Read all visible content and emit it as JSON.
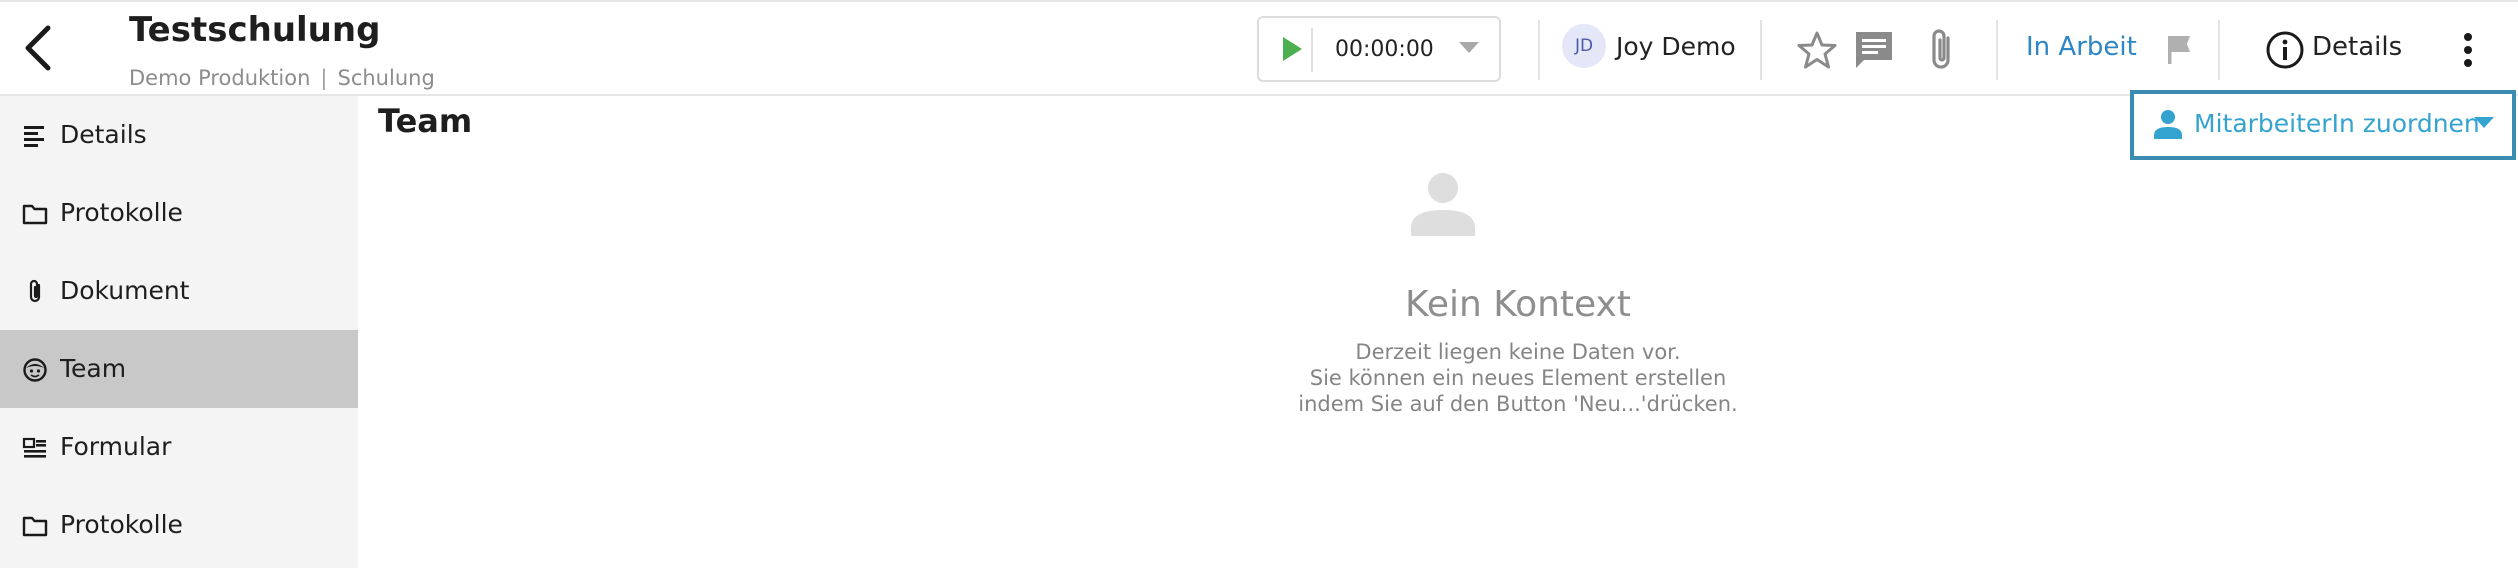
{
  "header": {
    "title": "Testschulung",
    "breadcrumb": [
      "Demo Produktion",
      "Schulung"
    ],
    "breadcrumb_separator": "|",
    "timer": {
      "value": "00:00:00"
    },
    "user": {
      "initials": "JD",
      "name": "Joy Demo"
    },
    "status": {
      "label": "In Arbeit",
      "color": "#2f86c5"
    },
    "details_label": "Details"
  },
  "sidebar": {
    "items": [
      {
        "label": "Details",
        "icon": "notes-icon",
        "active": false
      },
      {
        "label": "Protokolle",
        "icon": "folder-icon",
        "active": false
      },
      {
        "label": "Dokument",
        "icon": "paperclip-icon",
        "active": false
      },
      {
        "label": "Team",
        "icon": "face-icon",
        "active": true
      },
      {
        "label": "Formular",
        "icon": "form-icon",
        "active": false
      },
      {
        "label": "Protokolle",
        "icon": "folder-icon",
        "active": false
      }
    ]
  },
  "main": {
    "section_title": "Team",
    "assign_button": {
      "label": "MitarbeiterIn zuordnen",
      "color": "#34a3cf"
    },
    "empty_state": {
      "title": "Kein Kontext",
      "lines": [
        "Derzeit liegen keine Daten vor.",
        "Sie können ein neues Element erstellen",
        "indem Sie auf den Button 'Neu...'drücken."
      ]
    }
  }
}
